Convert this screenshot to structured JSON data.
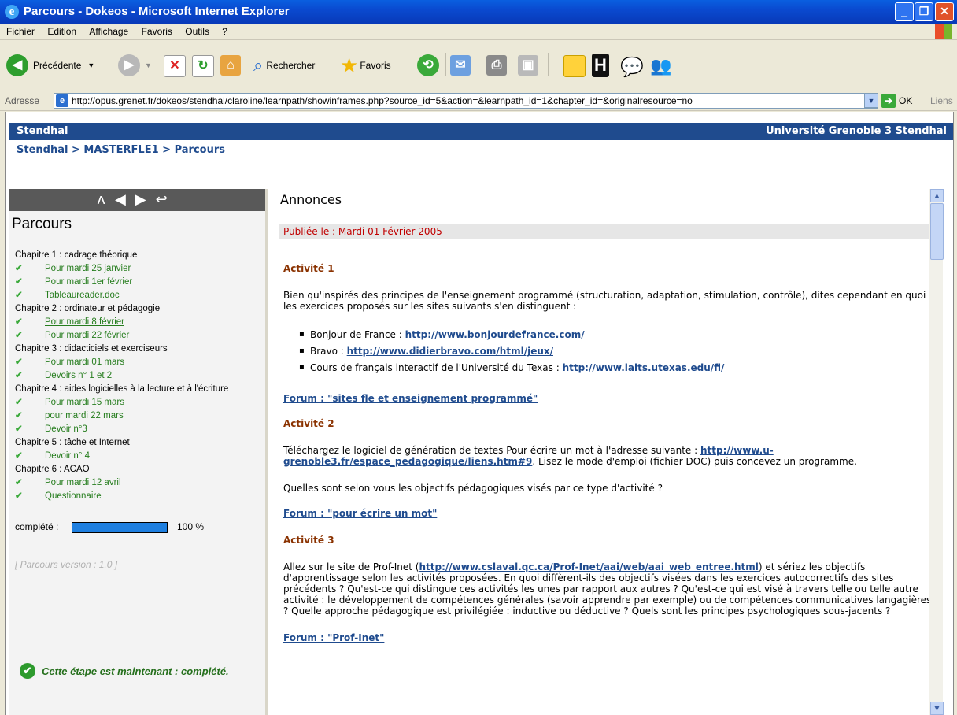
{
  "window": {
    "title": "Parcours - Dokeos - Microsoft Internet Explorer"
  },
  "menu": [
    "Fichier",
    "Edition",
    "Affichage",
    "Favoris",
    "Outils",
    "?"
  ],
  "toolbar": {
    "back_label": "Précédente",
    "search_label": "Rechercher",
    "favorites_label": "Favoris"
  },
  "address": {
    "label": "Adresse",
    "url": "http://opus.grenet.fr/dokeos/stendhal/claroline/learnpath/showinframes.php?source_id=5&action=&learnpath_id=1&chapter_id=&originalresource=no",
    "go_label": "OK",
    "links_label": "Liens"
  },
  "banner": {
    "left": "Stendhal",
    "right": "Université Grenoble 3 Stendhal"
  },
  "breadcrumb": {
    "item1": "Stendhal",
    "sep1": " > ",
    "item2": "MASTERFLE1",
    "sep2": " > ",
    "item3": "Parcours"
  },
  "left": {
    "nav_icons": [
      "trail-icon",
      "back-arrow-icon",
      "forward-arrow-icon",
      "return-icon"
    ],
    "title": "Parcours",
    "toc": [
      {
        "type": "chapter",
        "label": "Chapitre 1 : cadrage théorique"
      },
      {
        "type": "item",
        "label": "Pour mardi 25 janvier"
      },
      {
        "type": "item",
        "label": "Pour mardi 1er février"
      },
      {
        "type": "item",
        "label": "Tableaureader.doc"
      },
      {
        "type": "chapter",
        "label": "Chapitre 2 : ordinateur et pédagogie"
      },
      {
        "type": "item",
        "label": "Pour mardi 8 février",
        "current": true
      },
      {
        "type": "item",
        "label": "Pour mardi 22 février"
      },
      {
        "type": "chapter",
        "label": "Chapitre 3 : didacticiels et exerciseurs"
      },
      {
        "type": "item",
        "label": "Pour mardi 01 mars"
      },
      {
        "type": "item",
        "label": "Devoirs n° 1 et 2"
      },
      {
        "type": "chapter",
        "label": "Chapitre 4 : aides logicielles à la lecture et à l'écriture"
      },
      {
        "type": "item",
        "label": "Pour mardi 15 mars"
      },
      {
        "type": "item",
        "label": "pour mardi 22 mars"
      },
      {
        "type": "item",
        "label": "Devoir n°3"
      },
      {
        "type": "chapter",
        "label": "Chapitre 5 : tâche et Internet"
      },
      {
        "type": "item",
        "label": "Devoir n° 4"
      },
      {
        "type": "chapter",
        "label": "Chapitre 6 : ACAO"
      },
      {
        "type": "item",
        "label": "Pour mardi 12 avril"
      },
      {
        "type": "item",
        "label": "Questionnaire"
      }
    ],
    "progress_label": "complété :",
    "progress_value": 100,
    "progress_text": "100 %",
    "version": "[ Parcours version : 1.0 ]",
    "status": "Cette étape est maintenant : complété."
  },
  "right": {
    "title": "Annonces",
    "published": "Publiée le : Mardi 01 Février 2005",
    "act1_title": "Activité 1",
    "act1_text": "Bien qu'inspirés des principes de l'enseignement programmé (structuration, adaptation, stimulation, contrôle), dites cependant en quoi les exercices proposés sur les sites suivants s'en distinguent :",
    "links": [
      {
        "label": "Bonjour de France : ",
        "url": "http://www.bonjourdefrance.com/"
      },
      {
        "label": "Bravo : ",
        "url": "http://www.didierbravo.com/html/jeux/"
      },
      {
        "label": "Cours de français interactif de l'Université du Texas : ",
        "url": "http://www.laits.utexas.edu/fi/"
      }
    ],
    "forum1": "Forum : \"sites fle et enseignement programmé\"",
    "act2_title": "Activité 2",
    "act2_text_a": "Téléchargez le logiciel de génération de textes Pour écrire un mot à l'adresse suivante : ",
    "act2_link": "http://www.u-grenoble3.fr/espace_pedagogique/liens.htm#9",
    "act2_text_b": ". Lisez le mode d'emploi (fichier DOC) puis concevez un programme.",
    "act2_question": "Quelles sont selon vous les objectifs pédagogiques visés par ce type d'activité ?",
    "forum2": "Forum : \"pour écrire un mot\"",
    "act3_title": "Activité 3",
    "act3_text_a": "Allez sur le site de Prof-Inet (",
    "act3_link": "http://www.cslaval.qc.ca/Prof-Inet/aai/web/aai_web_entree.html",
    "act3_text_b": ")  et sériez les objectifs d'apprentissage selon les activités proposées. En quoi diffèrent-ils des objectifs visées dans les exercices autocorrectifs des sites précédents ? Qu'est-ce qui distingue ces activités les unes par rapport aux autres ? Qu'est-ce qui est visé à travers telle ou telle autre activité : le développement de compétences générales (savoir apprendre par exemple) ou de compétences communicatives langagières ? Quelle approche pédagogique est privilégiée : inductive ou déductive ? Quels sont les principes psychologiques sous-jacents ?",
    "forum3": "Forum : \"Prof-Inet\""
  }
}
